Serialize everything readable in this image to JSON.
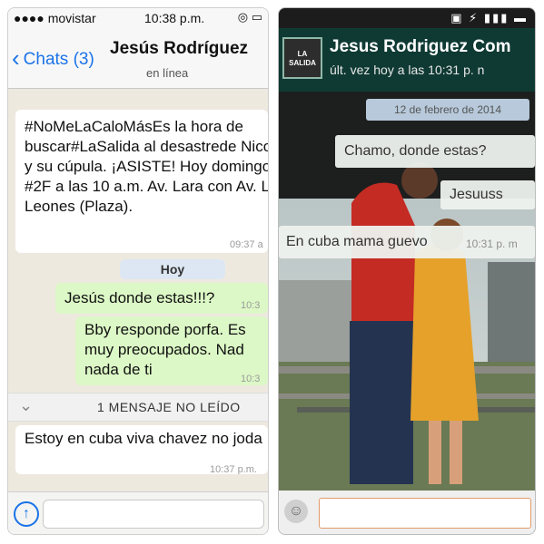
{
  "left": {
    "status_bar": {
      "carrier": "●●●● movistar",
      "time": "10:38 p.m.",
      "icons": "◎ ▭"
    },
    "header": {
      "back_label": "Chats (3)",
      "contact_name": "Jesús Rodríguez",
      "status": "en línea"
    },
    "messages": [
      {
        "text": "#NoMeLaCaloMásEs la hora de buscar#LaSalida al desastrede Nicolás y su cúpula. ¡ASISTE! Hoy domingo #2F a las 10 a.m. Av. Lara con Av. Los Leones (Plaza).",
        "time": "09:37 a",
        "direction": "incoming"
      },
      {
        "text": "Jesús donde estas!!!?",
        "time": "10:3",
        "direction": "outgoing"
      },
      {
        "text": "Bby responde porfa. Es muy preocupados. Nad nada de ti",
        "time": "10:3",
        "direction": "outgoing"
      },
      {
        "text": "Estoy en cuba viva chavez no joda",
        "time": "10:37 p.m.",
        "direction": "incoming"
      }
    ],
    "day_separator": "Hoy",
    "unread_banner": "1 MENSAJE NO LEÍDO",
    "share_icon": "share-icon"
  },
  "right": {
    "status_bar_icons": "▣ ⚡ ▮▮▮ ▬",
    "header": {
      "avatar_text": "LA SALIDA",
      "contact_name": "Jesus Rodriguez Com",
      "status": "últ. vez hoy a las 10:31 p. n"
    },
    "date_separator": "12 de febrero de 2014",
    "messages": [
      {
        "text": "Chamo, donde estas?",
        "direction": "outgoing"
      },
      {
        "text": "Jesuuss",
        "direction": "outgoing"
      },
      {
        "text": "En cuba mama guevo",
        "time": "10:31 p. m",
        "direction": "incoming"
      }
    ]
  },
  "colors": {
    "ios_accent": "#1a73e8",
    "outgoing_bubble": "#dcf8c6",
    "android_header": "#0f3a34"
  }
}
